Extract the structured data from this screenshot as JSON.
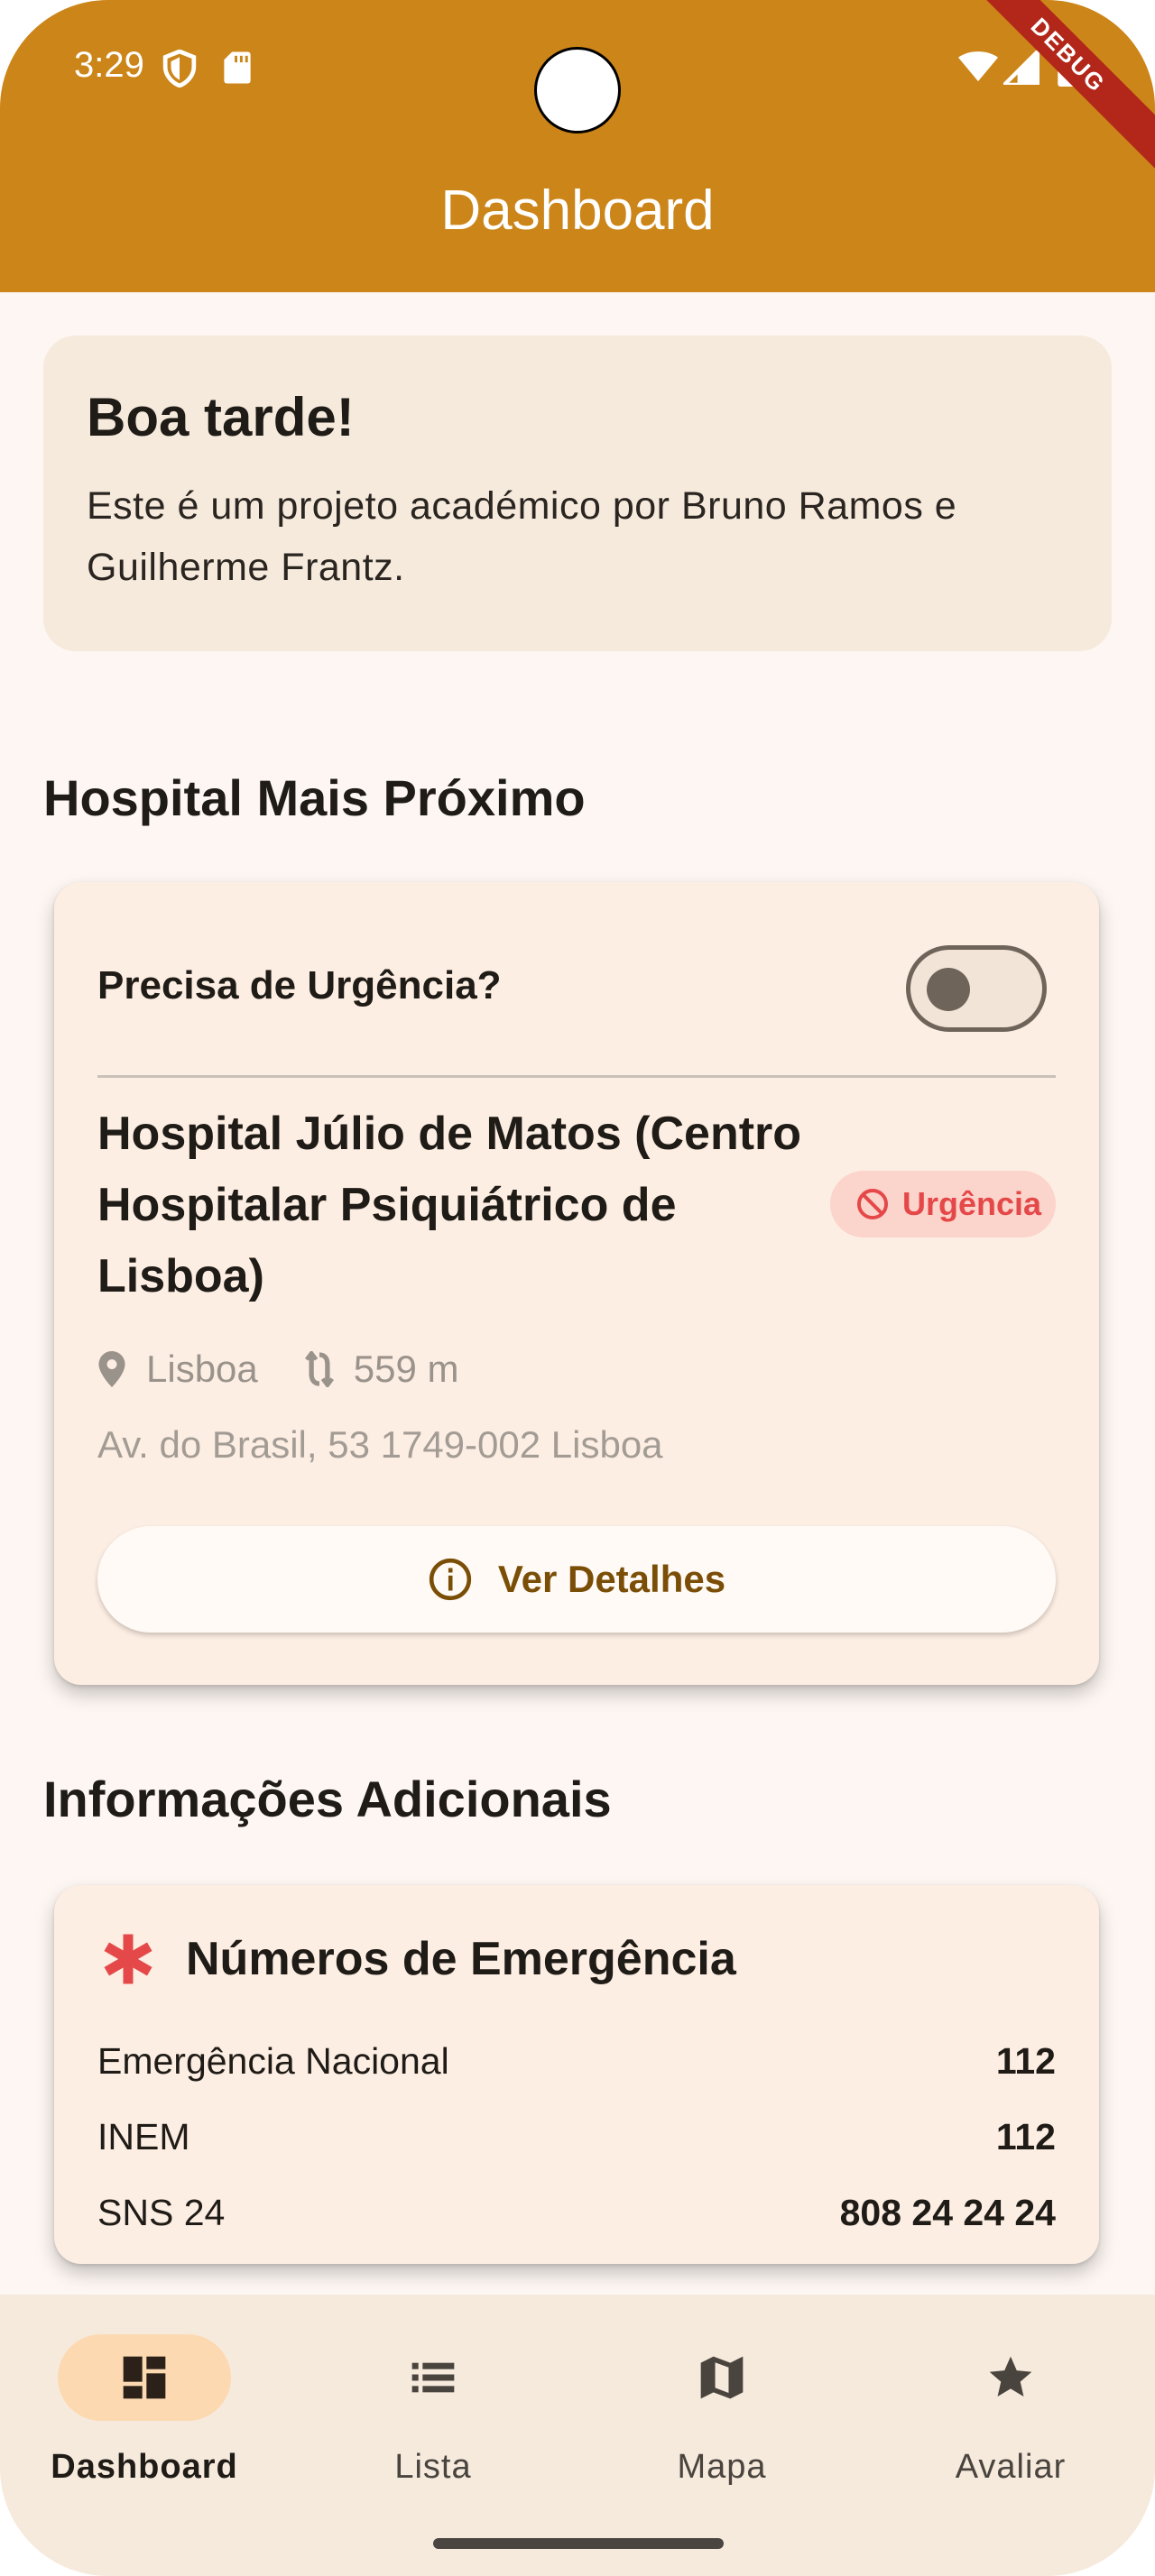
{
  "status_bar": {
    "time": "3:29",
    "debug_label": "DEBUG"
  },
  "appbar": {
    "title": "Dashboard",
    "color": "#cc8518"
  },
  "greeting": {
    "title": "Boa tarde!",
    "text": "Este é um projeto académico por Bruno Ramos e Guilherme Frantz."
  },
  "nearest": {
    "section_title": "Hospital Mais Próximo",
    "urgency_question": "Precisa de Urgência?",
    "urgency_toggle_on": false,
    "hospital_name": "Hospital Júlio de Matos (Centro Hospitalar Psiquiátrico de Lisboa)",
    "badge_label": "Urgência",
    "badge_icon": "block-icon",
    "city": "Lisboa",
    "distance": "559 m",
    "address": "Av. do Brasil, 53 1749-002 Lisboa",
    "details_button": "Ver Detalhes"
  },
  "additional": {
    "section_title": "Informações Adicionais",
    "emergency_title": "Números de Emergência",
    "numbers": [
      {
        "label": "Emergência Nacional",
        "number": "112"
      },
      {
        "label": "INEM",
        "number": "112"
      },
      {
        "label": "SNS 24",
        "number": "808 24 24 24"
      }
    ]
  },
  "nav": {
    "items": [
      {
        "label": "Dashboard",
        "icon": "dashboard-icon",
        "active": true
      },
      {
        "label": "Lista",
        "icon": "list-icon",
        "active": false
      },
      {
        "label": "Mapa",
        "icon": "map-icon",
        "active": false
      },
      {
        "label": "Avaliar",
        "icon": "star-icon",
        "active": false
      }
    ]
  },
  "colors": {
    "accent": "#cc8518",
    "urgent": "#e54848",
    "button_text": "#7a4e06"
  }
}
